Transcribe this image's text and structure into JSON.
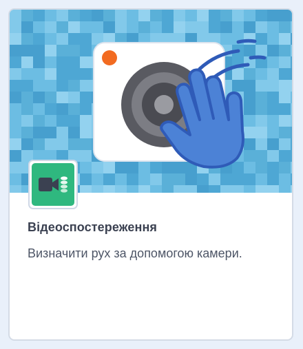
{
  "extension_card": {
    "title": "Відеоспостереження",
    "description": "Визначити рух за допомогою камери.",
    "banner_icon": "camera-with-waving-hand",
    "badge_icon": "video-camera-icon",
    "colors": {
      "banner_background": "#5ab0d8",
      "badge_background": "#2fb87f",
      "hand": "#4b7fd4",
      "camera_body": "#ffffff",
      "record_dot": "#f26b21"
    }
  }
}
